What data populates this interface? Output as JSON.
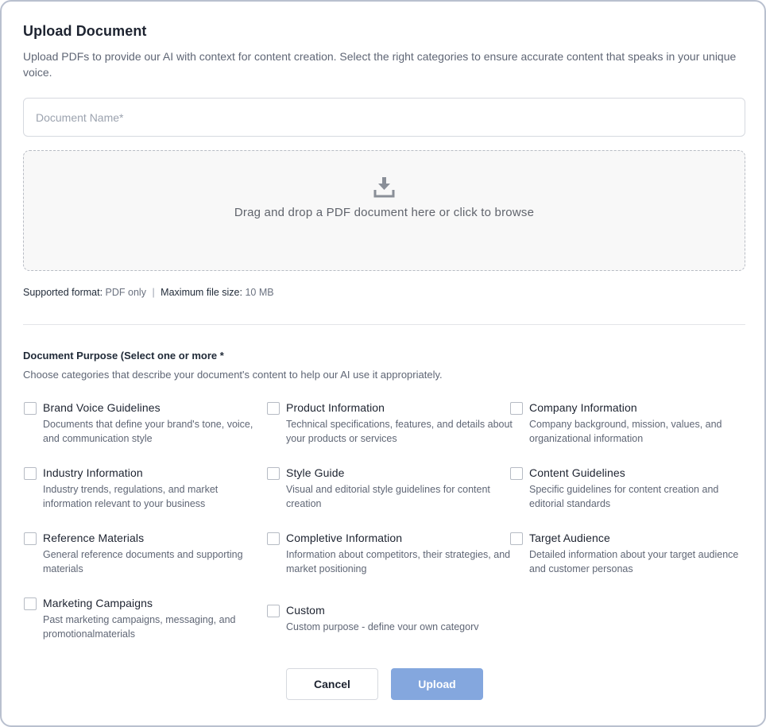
{
  "dialog": {
    "title": "Upload Document",
    "subtitle": "Upload PDFs to provide our AI with context for content creation. Select the right categories to ensure accurate content that speaks in your unique voice."
  },
  "document_name": {
    "placeholder": "Document Name*",
    "value": ""
  },
  "dropzone": {
    "icon": "download-icon",
    "text": "Drag and drop a PDF document here or click to browse"
  },
  "formats": {
    "format_label": "Supported format:",
    "format_value": "PDF only",
    "separator": "|",
    "size_label": "Maximum file size:",
    "size_value": "10 MB"
  },
  "purpose": {
    "title": "Document Purpose (Select one or more *",
    "subtitle": "Choose categories that describe your document's content to help our AI use it appropriately.",
    "options": [
      {
        "label": "Brand Voice Guidelines",
        "description": "Documents that define your brand's tone, voice, and communication style",
        "checked": false
      },
      {
        "label": "Product Information",
        "description": "Technical specifications, features, and details about your products or services",
        "checked": false
      },
      {
        "label": "Company Information",
        "description": "Company background, mission, values, and organizational information",
        "checked": false
      },
      {
        "label": "Industry Information",
        "description": "Industry trends, regulations, and market information relevant to your business",
        "checked": false
      },
      {
        "label": "Style Guide",
        "description": "Visual and editorial style guidelines for content creation",
        "checked": false
      },
      {
        "label": "Content Guidelines",
        "description": "Specific guidelines for content creation and editorial standards",
        "checked": false
      },
      {
        "label": "Reference Materials",
        "description": "General reference documents and supporting materials",
        "checked": false
      },
      {
        "label": "Completive Information",
        "description": "Information about competitors, their strategies, and market positioning",
        "checked": false
      },
      {
        "label": "Target Audience",
        "description": "Detailed information about your target audience and customer personas",
        "checked": false
      },
      {
        "label": "Marketing Campaigns",
        "description": "Past marketing campaigns, messaging, and promotionalmaterials",
        "checked": false
      },
      {
        "label": "Custom",
        "description": "Custom purpose - define vour own categorv",
        "checked": false
      }
    ]
  },
  "actions": {
    "cancel_label": "Cancel",
    "upload_label": "Upload"
  },
  "colors": {
    "upload_button_disabled": "#84a7de",
    "dropzone_bg": "#f8f8f8",
    "border": "#d6d9df"
  }
}
